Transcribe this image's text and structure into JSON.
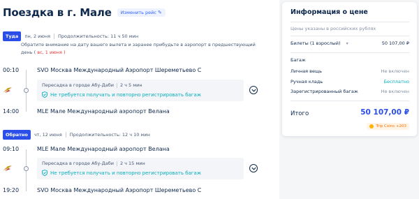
{
  "header": {
    "title": "Поездка в г. Мале",
    "change_label": "Изменить рейс",
    "change_icon": "pencil-icon"
  },
  "outbound": {
    "badge": "Туда",
    "date": "пн, 2 июня",
    "duration": "Продолжительность: 11 ч 50 мин",
    "notice_text": "Обратите внимание на дату вашего вылета и заранее прибудьте в аэропорт в предшествующий день (",
    "notice_date": "вс, 1 июня",
    "notice_close": ")",
    "dep_time": "00:10",
    "dep_airport": "SVO Москва Международный Аэропорт Шереметьево C",
    "transfer_city": "Пересадка в городе Абу-Даби",
    "transfer_duration": "2 ч 5 мин",
    "transfer_note": "Не требуется получать и повторно регистрировать багаж",
    "arr_time": "14:00",
    "arr_airport": "MLE Мале Международный аэропорт Велана"
  },
  "return": {
    "badge": "Обратно",
    "date": "чт, 12 июня",
    "duration": "Продолжительность: 12 ч 10 мин",
    "dep_time": "09:10",
    "dep_airport": "MLE Мале Международный аэропорт Велана",
    "transfer_city": "Пересадка в городе Абу-Даби",
    "transfer_duration": "2 ч 15 мин",
    "transfer_note": "Не требуется получать и повторно регистрировать багаж",
    "arr_time": "19:20",
    "arr_airport": "SVO Москва Международный Аэропорт Шереметьево C"
  },
  "price_card": {
    "title": "Информация о цене",
    "subtitle": "Цены указаны в российских рублях",
    "tickets_label": "Билеты (1 взрослый)",
    "tickets_value": "50 107,00 ₽",
    "baggage_heading": "Багаж",
    "baggage": [
      {
        "label": "Личная вещь",
        "value": "Не включен"
      },
      {
        "label": "Ручная кладь",
        "value": "Бесплатно"
      },
      {
        "label": "Зарегистрированный багаж",
        "value": "Не включен"
      }
    ],
    "total_label": "Итого",
    "total_value": "50 107,00 ₽",
    "coins": "Trip Coins +203"
  },
  "colors": {
    "accent": "#2c4ee8",
    "teal": "#06aebd",
    "warning": "#e63333",
    "text": "#0f294d"
  }
}
